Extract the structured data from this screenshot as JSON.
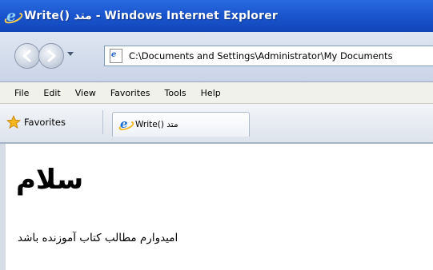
{
  "window": {
    "title": "Write() متد - Windows Internet Explorer"
  },
  "address_bar": {
    "url": "C:\\Documents and Settings\\Administrator\\My Documents"
  },
  "menu": {
    "items": [
      "File",
      "Edit",
      "View",
      "Favorites",
      "Tools",
      "Help"
    ]
  },
  "favorites_bar": {
    "favorites_label": "Favorites",
    "tab_label": "Write() متد"
  },
  "page": {
    "heading": "سلام",
    "body_text": "امیدوارم مطالب کتاب آموزنده باشد"
  },
  "colors": {
    "title_bar": "#1b56cf",
    "accent": "#2a6be0"
  },
  "icons": {
    "title_icon": "internet-explorer-icon",
    "back": "back-arrow-icon",
    "forward": "forward-arrow-icon",
    "page": "page-icon",
    "favorites": "favorites-star-icon",
    "tab": "internet-explorer-icon"
  }
}
